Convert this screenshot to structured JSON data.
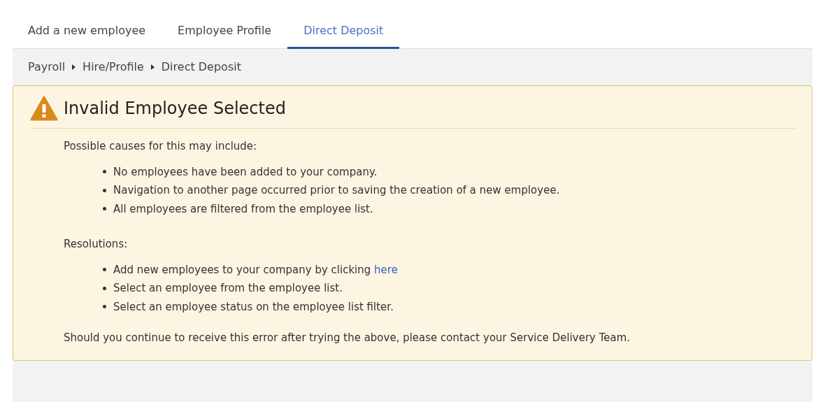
{
  "tabs": [
    {
      "label": "Add a new employee",
      "selected": false
    },
    {
      "label": "Employee Profile",
      "selected": false
    },
    {
      "label": "Direct Deposit",
      "selected": true
    }
  ],
  "breadcrumb": [
    "Payroll",
    "Hire/Profile",
    "Direct Deposit"
  ],
  "alert": {
    "title": "Invalid Employee Selected",
    "causes_heading": "Possible causes for this may include:",
    "causes": [
      {
        "text": "No employees have been added to your company."
      },
      {
        "text": "Navigation to another page occurred prior to saving the creation of a new employee."
      },
      {
        "text": "All employees are filtered from the employee list."
      }
    ],
    "resolutions_heading": "Resolutions:",
    "resolutions": [
      {
        "text": "Add new employees to your company by clicking",
        "link": "here"
      },
      {
        "text": "Select an employee from the employee list."
      },
      {
        "text": "Select an employee status on the employee list filter."
      }
    ],
    "footer": "Should you continue to receive this error after trying the above, please contact your Service Delivery Team."
  }
}
